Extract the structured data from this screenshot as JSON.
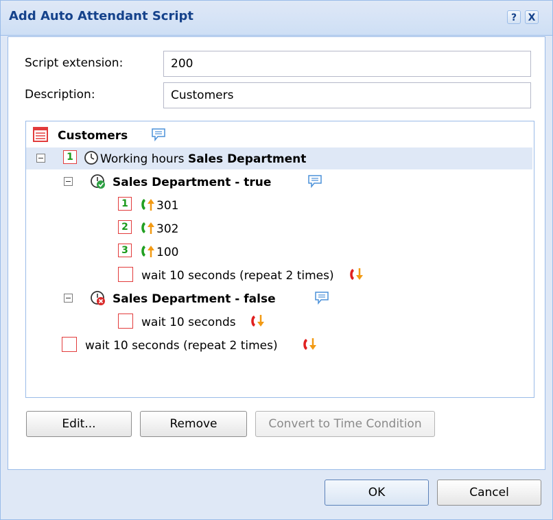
{
  "window": {
    "title": "Add Auto Attendant Script",
    "help_label": "?",
    "close_label": "X"
  },
  "form": {
    "extension_label": "Script extension:",
    "extension_value": "200",
    "description_label": "Description:",
    "description_value": "Customers"
  },
  "tree": {
    "root_label": "Customers",
    "cond_number": "1",
    "cond_prefix": "Working hours ",
    "cond_name": "Sales Department",
    "true_label": "Sales Department - true",
    "true_items": [
      {
        "num": "1",
        "label": "301"
      },
      {
        "num": "2",
        "label": "302"
      },
      {
        "num": "3",
        "label": "100"
      }
    ],
    "true_wait": "wait 10 seconds (repeat 2 times)",
    "false_label": "Sales Department - false",
    "false_wait": "wait 10 seconds",
    "root_wait": "wait 10 seconds (repeat 2 times)"
  },
  "buttons": {
    "edit": "Edit...",
    "remove": "Remove",
    "convert": "Convert to Time Condition",
    "ok": "OK",
    "cancel": "Cancel"
  },
  "colors": {
    "title_text": "#15428b",
    "panel_bg": "#dfe8f6",
    "border": "#99bbe8",
    "number_border": "#e23b3b",
    "number_text": "#1a9a1a",
    "forward_green": "#22a022",
    "hangup_red": "#e02020",
    "arrow_orange": "#f29a13"
  },
  "icons": [
    "help-icon",
    "close-icon",
    "script-list-icon",
    "comment-icon",
    "clock-icon",
    "condition-true-icon",
    "condition-false-icon",
    "forward-call-icon",
    "hangup-call-icon",
    "collapse-icon"
  ]
}
